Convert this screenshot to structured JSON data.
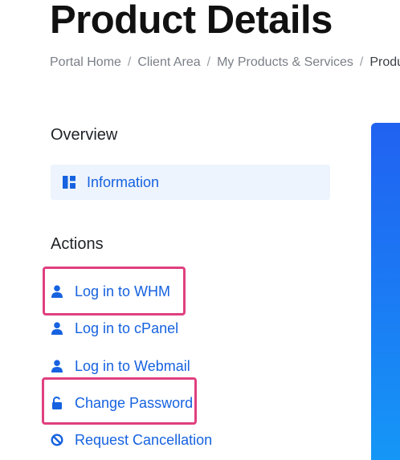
{
  "page": {
    "title": "Product Details"
  },
  "breadcrumb": [
    {
      "label": "Portal Home"
    },
    {
      "label": "Client Area"
    },
    {
      "label": "My Products & Services"
    },
    {
      "label": "Produ"
    }
  ],
  "breadcrumb_separator": "/",
  "overview": {
    "heading": "Overview",
    "items": [
      {
        "label": "Information",
        "icon": "dashboard-icon"
      }
    ]
  },
  "actions": {
    "heading": "Actions",
    "items": [
      {
        "label": "Log in to WHM",
        "icon": "user-icon"
      },
      {
        "label": "Log in to cPanel",
        "icon": "user-icon"
      },
      {
        "label": "Log in to Webmail",
        "icon": "user-icon"
      },
      {
        "label": "Change Password",
        "icon": "unlock-icon"
      },
      {
        "label": "Request Cancellation",
        "icon": "ban-icon"
      }
    ]
  },
  "colors": {
    "link": "#1662e0",
    "highlight": "#e0407f",
    "panel": "#2162f1"
  }
}
